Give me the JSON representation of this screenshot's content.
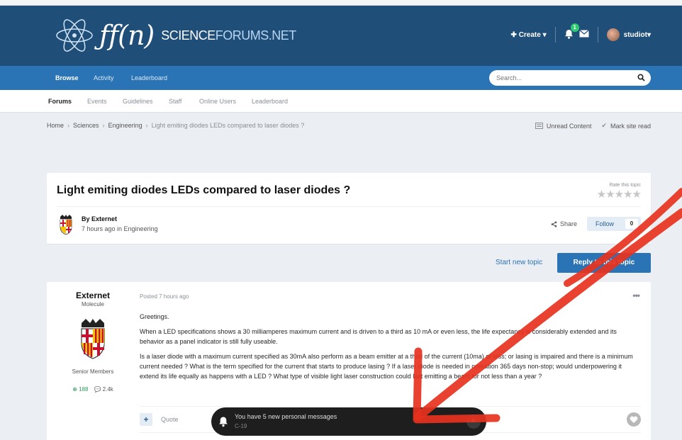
{
  "site": {
    "logo_fn": "ƒf(n)",
    "logo_part1": "SCIENCE",
    "logo_part2": "FORUMS.NET"
  },
  "user_nav": {
    "create_label": "Create",
    "notification_count": "1",
    "username": "studiot"
  },
  "navbar": {
    "items": [
      {
        "label": "Browse",
        "active": true
      },
      {
        "label": "Activity",
        "active": false
      },
      {
        "label": "Leaderboard",
        "active": false
      }
    ],
    "search_placeholder": "Search..."
  },
  "subnav": {
    "items": [
      {
        "label": "Forums",
        "active": true
      },
      {
        "label": "Events",
        "active": false
      },
      {
        "label": "Guidelines",
        "active": false
      },
      {
        "label": "Staff",
        "active": false
      },
      {
        "label": "Online Users",
        "active": false
      },
      {
        "label": "Leaderboard",
        "active": false
      }
    ]
  },
  "breadcrumb": {
    "items": [
      "Home",
      "Sciences",
      "Engineering"
    ],
    "current": "Light emiting diodes LEDs compared to laser diodes ?",
    "unread_label": "Unread Content",
    "mark_read_label": "Mark site read"
  },
  "topic": {
    "title": "Light emiting diodes LEDs compared to laser diodes ?",
    "rate_label": "Rate this topic",
    "stars": "★★★★★",
    "by_label": "By Externet",
    "posted_meta": "7 hours ago in Engineering",
    "share_label": "Share",
    "follow_label": "Follow",
    "follow_count": "0"
  },
  "actions": {
    "start_new_topic": "Start new topic",
    "reply_label": "Reply to this topic"
  },
  "post": {
    "author": "Externet",
    "rank": "Molecule",
    "group": "Senior Members",
    "reputation": "188",
    "posts": "2.4k",
    "posted": "Posted 7 hours ago",
    "paragraphs": [
      "Greetings.",
      "When a LED specifications shows a 30 milliamperes maximum current and is driven to a third as 10 mA or even less, the life expectancy is considerably extended and its behavior as a panel indicator is still fully useable.",
      "Is a laser diode with a maximum current specified as 30mA also perform as a beam emitter at a third of the current (10ma) or less; or lasing is impaired and there is a minimum current needed ?   What is the term specified for the current that starts to produce lasing ?   If a laser diode is needed in operation 365 days non-stop; would underpowering it extend its life equally as happens with a LED ?  What type of visible light laser construction could last emitting a beam  for not less than a year ?"
    ],
    "quote_label": "Quote"
  },
  "toast": {
    "message": "You have 5 new personal messages",
    "sub": "C-19"
  }
}
